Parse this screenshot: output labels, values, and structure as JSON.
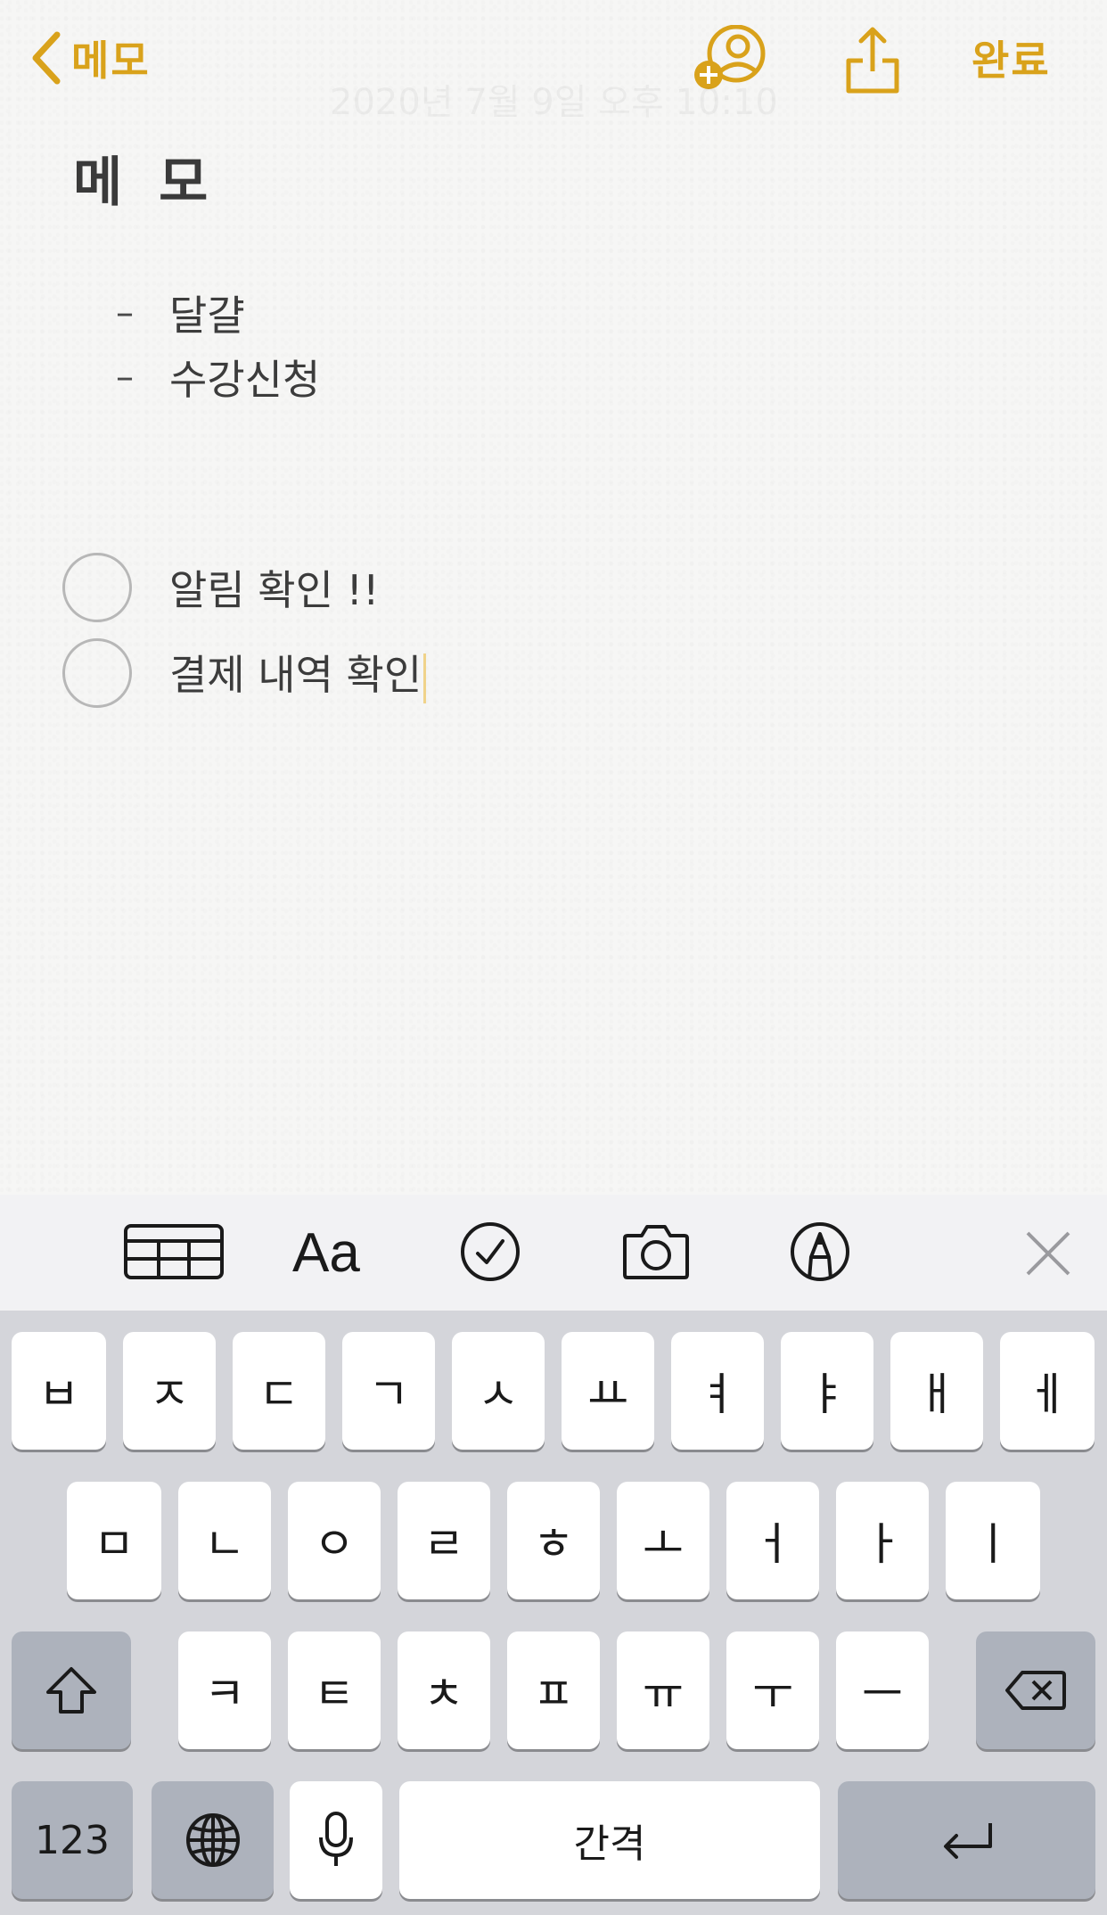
{
  "nav": {
    "back_label": "메모",
    "done_label": "완료",
    "faded_date": "2020년 7월 9일 오후 10:10"
  },
  "note": {
    "title": "메 모",
    "dash_items": [
      "달걀",
      "수강신청"
    ],
    "checklist": [
      {
        "text": "알림 확인 !!",
        "checked": false
      },
      {
        "text": "결제 내역 확인",
        "checked": false
      }
    ]
  },
  "toolbar": {
    "icons": [
      "table-icon",
      "format-icon",
      "checklist-icon",
      "camera-icon",
      "markup-icon",
      "close-icon"
    ],
    "format_label": "Aa"
  },
  "keyboard": {
    "row1": [
      "ㅂ",
      "ㅈ",
      "ㄷ",
      "ㄱ",
      "ㅅ",
      "ㅛ",
      "ㅕ",
      "ㅑ",
      "ㅐ",
      "ㅔ"
    ],
    "row2": [
      "ㅁ",
      "ㄴ",
      "ㅇ",
      "ㄹ",
      "ㅎ",
      "ㅗ",
      "ㅓ",
      "ㅏ",
      "ㅣ"
    ],
    "row3": [
      "ㅋ",
      "ㅌ",
      "ㅊ",
      "ㅍ",
      "ㅠ",
      "ㅜ",
      "ㅡ"
    ],
    "numbers_label": "123",
    "space_label": "간격"
  },
  "colors": {
    "accent": "#d9a21b",
    "paper": "#f6f6f5",
    "keyboard_bg": "#d4d5da"
  }
}
